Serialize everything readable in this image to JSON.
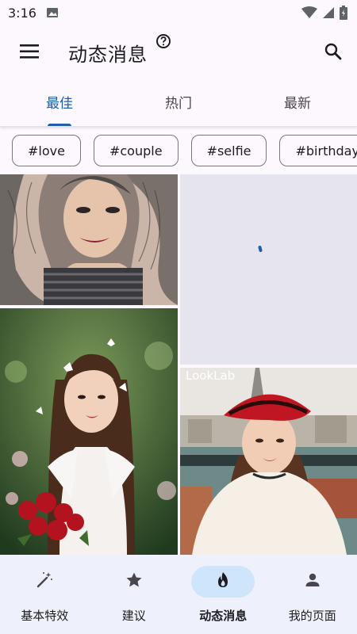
{
  "status_bar": {
    "time": "3:16"
  },
  "app_bar": {
    "title": "动态消息"
  },
  "tabs": [
    {
      "label": "最佳",
      "active": true
    },
    {
      "label": "热门",
      "active": false
    },
    {
      "label": "最新",
      "active": false
    }
  ],
  "chips": [
    "#love",
    "#couple",
    "#selfie",
    "#birthday"
  ],
  "feed": {
    "watermark": "LookLab"
  },
  "bottom_nav": [
    {
      "label": "基本特效",
      "icon": "magic-wand-icon",
      "active": false
    },
    {
      "label": "建议",
      "icon": "star-icon",
      "active": false
    },
    {
      "label": "动态消息",
      "icon": "fire-icon",
      "active": true
    },
    {
      "label": "我的页面",
      "icon": "person-icon",
      "active": false
    }
  ],
  "colors": {
    "accent": "#1f5fa6",
    "nav_background": "#eef1fb",
    "nav_active_pill": "#cfe5fb"
  }
}
